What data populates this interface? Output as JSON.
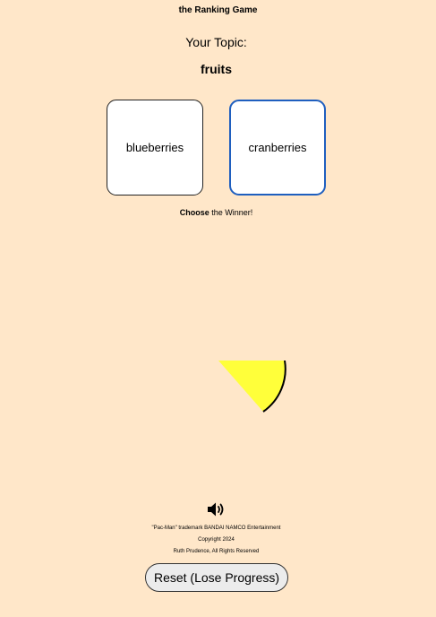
{
  "game": {
    "title": "the Ranking Game"
  },
  "topic": {
    "label": "Your Topic:",
    "value": "fruits"
  },
  "choices": [
    {
      "label": "blueberries",
      "selected": false
    },
    {
      "label": "cranberries",
      "selected": true
    }
  ],
  "instruction": {
    "strong": "Choose",
    "rest": " the Winner!"
  },
  "sound": {
    "icon": "speaker-volume-icon"
  },
  "footer": {
    "trademark": "\"Pac-Man\" trademark BANDAI NAMCO Entertainment",
    "copyright": "Copyright 2024",
    "author": "Ruth Prudence, All Rights Reserved"
  },
  "reset_button": {
    "label": "Reset (Lose Progress)"
  },
  "colors": {
    "background": "#ffe7c9",
    "pacman": "#ffff3a",
    "selected_border": "#1f5fbf"
  }
}
